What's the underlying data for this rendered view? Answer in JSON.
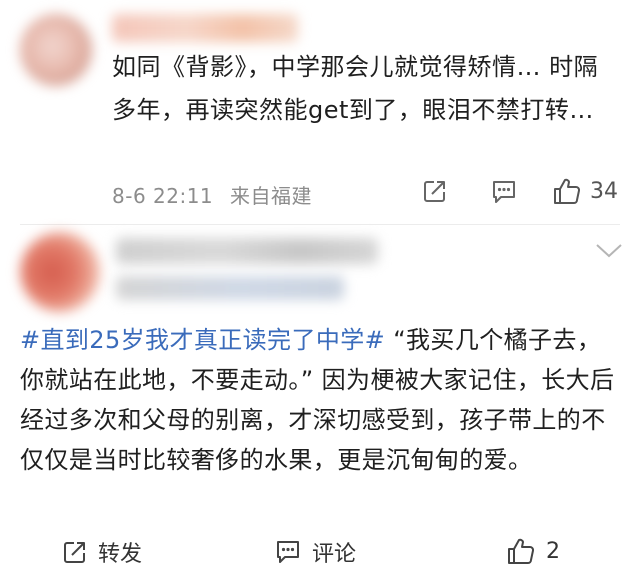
{
  "comment1": {
    "text": "如同《背影》，中学那会儿就觉得矫情… 时隔多年，再读突然能get到了，眼泪不禁打转…",
    "time": "8-6 22:11",
    "location": "来自福建",
    "like_count": "34"
  },
  "comment2": {
    "hashtag": "#直到25岁我才真正读完了中学#",
    "text": " “我买几个橘子去，你就站在此地，不要走动。” 因为梗被大家记住，长大后经过多次和父母的别离，才深切感受到，孩子带上的不仅仅是当时比较奢侈的水果，更是沉甸甸的爱。"
  },
  "actions": {
    "repost_label": "转发",
    "comment_label": "评论",
    "like_count": "2"
  },
  "icons": {
    "share": "share-icon",
    "comment": "comment-icon",
    "like": "thumbs-up-icon",
    "chevron": "chevron-down-icon"
  }
}
